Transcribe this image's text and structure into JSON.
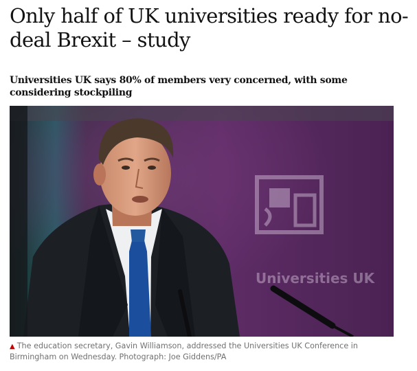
{
  "article": {
    "headline": "Only half of UK universities ready for no-deal Brexit – study",
    "standfirst": "Universities UK says 80% of members very concerned, with some considering stockpiling",
    "photo": {
      "backdrop_logo_text": "Universities UK"
    },
    "caption": {
      "text": "The education secretary, Gavin Williamson, addressed the Universities UK Conference in Birmingham on Wednesday. Photograph: Joe Giddens/PA",
      "marker_color": "#c70000"
    }
  },
  "colors": {
    "text": "#121212",
    "caption": "#707070",
    "backdrop": "#5a2c63"
  }
}
